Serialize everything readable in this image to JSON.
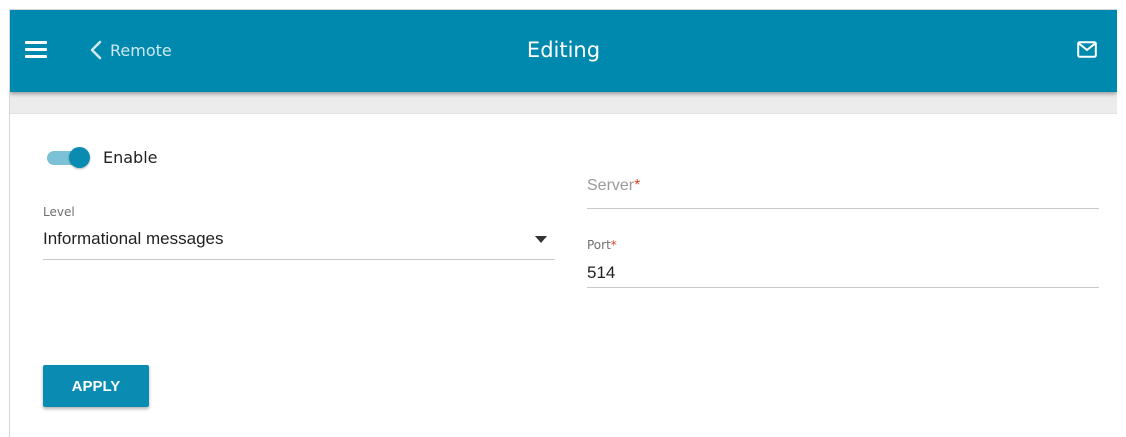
{
  "header": {
    "back_label": "Remote",
    "title": "Editing",
    "bg_color": "#0089ae",
    "icons": {
      "menu": "hamburger-menu-icon",
      "back": "chevron-left-icon",
      "notifications": "mail-envelope-icon"
    }
  },
  "form": {
    "enable": {
      "label": "Enable",
      "checked": true
    },
    "level": {
      "label": "Level",
      "value": "Informational messages",
      "arrow_icon": "caret-down-icon"
    },
    "server": {
      "label": "Server",
      "required_mark": "*",
      "value": ""
    },
    "port": {
      "label": "Port",
      "required_mark": "*",
      "value": "514"
    },
    "apply_label": "APPLY"
  },
  "colors": {
    "accent": "#0a8bb1",
    "required": "#e0462a"
  }
}
